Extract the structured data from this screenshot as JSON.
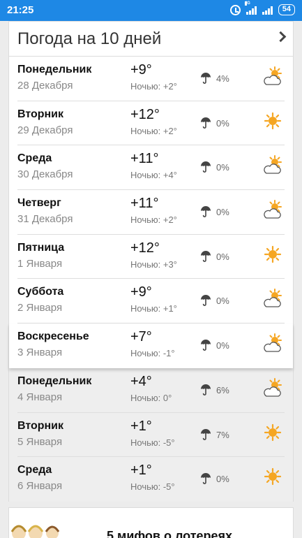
{
  "status_bar": {
    "time": "21:25",
    "network": "4G",
    "battery": "54"
  },
  "widget": {
    "title": "Погода на 10 дней"
  },
  "days": [
    {
      "day": "Понедельник",
      "date": "28 Декабря",
      "temp": "+9°",
      "night": "Ночью: +2°",
      "precip": "4%",
      "icon": "sun-cloud-icon",
      "highlighted": true
    },
    {
      "day": "Вторник",
      "date": "29 Декабря",
      "temp": "+12°",
      "night": "Ночью: +2°",
      "precip": "0%",
      "icon": "sun-icon",
      "highlighted": true
    },
    {
      "day": "Среда",
      "date": "30 Декабря",
      "temp": "+11°",
      "night": "Ночью: +4°",
      "precip": "0%",
      "icon": "sun-cloud-icon",
      "highlighted": true
    },
    {
      "day": "Четверг",
      "date": "31 Декабря",
      "temp": "+11°",
      "night": "Ночью: +2°",
      "precip": "0%",
      "icon": "sun-cloud-icon",
      "highlighted": true
    },
    {
      "day": "Пятница",
      "date": "1 Января",
      "temp": "+12°",
      "night": "Ночью: +3°",
      "precip": "0%",
      "icon": "sun-icon",
      "highlighted": true
    },
    {
      "day": "Суббота",
      "date": "2 Января",
      "temp": "+9°",
      "night": "Ночью: +1°",
      "precip": "0%",
      "icon": "sun-cloud-icon",
      "highlighted": true
    },
    {
      "day": "Воскресенье",
      "date": "3 Января",
      "temp": "+7°",
      "night": "Ночью: -1°",
      "precip": "0%",
      "icon": "sun-cloud-icon",
      "highlighted": true
    },
    {
      "day": "Понедельник",
      "date": "4 Января",
      "temp": "+4°",
      "night": "Ночью: 0°",
      "precip": "6%",
      "icon": "sun-cloud-icon",
      "highlighted": false
    },
    {
      "day": "Вторник",
      "date": "5 Января",
      "temp": "+1°",
      "night": "Ночью: -5°",
      "precip": "7%",
      "icon": "sun-icon",
      "highlighted": false
    },
    {
      "day": "Среда",
      "date": "6 Января",
      "temp": "+1°",
      "night": "Ночью: -5°",
      "precip": "0%",
      "icon": "sun-icon",
      "highlighted": false
    }
  ],
  "ad": {
    "title": "5 мифов о лотереях"
  },
  "colors": {
    "status_bar": "#1e88e5",
    "sun": "#f5a623",
    "cloud": "#555555"
  }
}
